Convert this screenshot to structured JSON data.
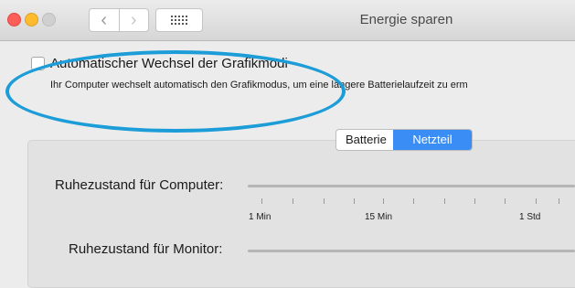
{
  "window": {
    "title": "Energie sparen",
    "nav_back_glyph": "‹",
    "nav_forward_glyph": "›"
  },
  "options": {
    "auto_graphics_switching": {
      "label": "Automatischer Wechsel der Grafikmodi",
      "description": "Ihr Computer wechselt automatisch den Grafikmodus, um eine längere Batterielaufzeit zu erm",
      "checked": false
    }
  },
  "tabs": {
    "items": [
      "Batterie",
      "Netzteil"
    ],
    "selected": "Netzteil"
  },
  "settings": {
    "computer_sleep_label": "Ruhezustand für Computer:",
    "monitor_sleep_label": "Ruhezustand für Monitor:",
    "tick_labels": [
      "1 Min",
      "15 Min",
      "1 Std"
    ]
  },
  "colors": {
    "selected_tab": "#3b8df6",
    "annotation_circle": "#1d9dd8"
  }
}
